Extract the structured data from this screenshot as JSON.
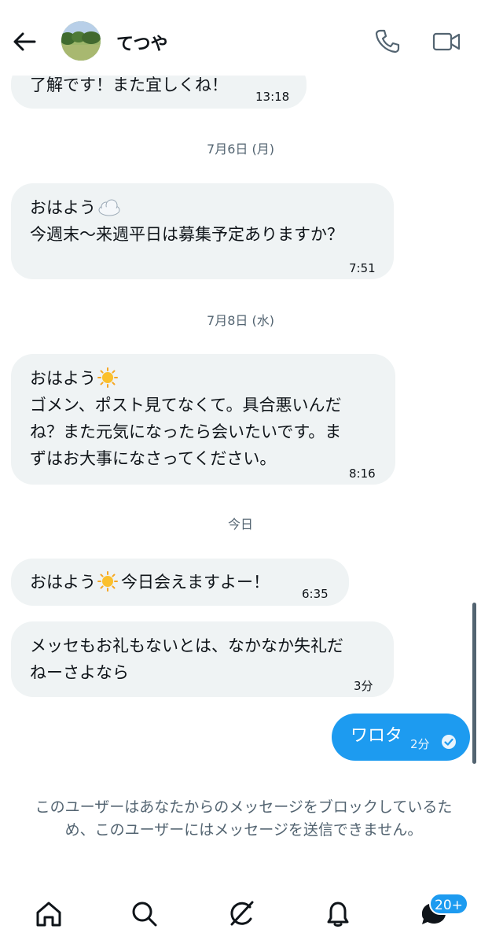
{
  "header": {
    "contact_name": "てつや"
  },
  "messages": [
    {
      "text": "了解です！また宜しくね！",
      "time": "13:18"
    },
    {
      "text_lines": [
        "おはよう",
        "今週末〜来週平日は募集予定ありますか？"
      ],
      "emoji": "cloud-emoji",
      "time": "7:51"
    },
    {
      "text_lines": [
        "おはよう",
        "ゴメン、ポスト見てなくて。具合悪いんだ\nね？また元気になったら会いたいです。ま\nずはお大事になさってください。"
      ],
      "emoji": "sun-emoji",
      "time": "8:16"
    },
    {
      "text_before": "おはよう",
      "text_after": "今日会えますよー！",
      "emoji": "sun-emoji",
      "time": "6:35"
    },
    {
      "text": "メッセもお礼もないとは、なかなか失礼だ\nねーさよなら",
      "time": "3分"
    }
  ],
  "own_message": {
    "text": "ワロタ",
    "time": "2分",
    "status": "read-check-icon"
  },
  "date_separators": [
    "7月6日 (月)",
    "7月8日 (水)",
    "今日"
  ],
  "block_notice": "このユーザーはあなたからのメッセージをブロックしているため、このユーザーにはメッセージを送信できません。",
  "bottom_nav": {
    "items": [
      "home-icon",
      "search-icon",
      "grok-icon",
      "notifications-icon",
      "messages-icon"
    ],
    "messages_badge": "20+"
  },
  "colors": {
    "accent": "#1d9bf0",
    "bubble": "#eff3f4",
    "muted_text": "#536471"
  }
}
